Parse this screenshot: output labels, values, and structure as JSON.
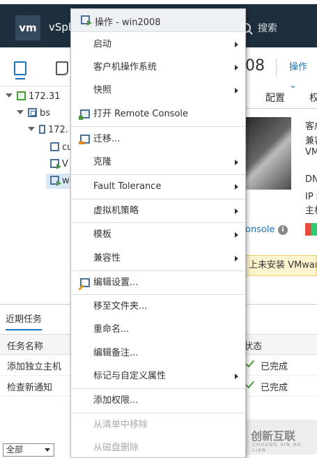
{
  "topbar": {
    "logo": "vm",
    "title": "vSph",
    "search_label": "搜索"
  },
  "tree": {
    "items": [
      {
        "label": "172.31"
      },
      {
        "label": "bs"
      },
      {
        "label": "172."
      },
      {
        "label": "cu"
      },
      {
        "label": "V"
      },
      {
        "label": "wi"
      }
    ]
  },
  "content": {
    "vm_name_fragment": "08",
    "actions_label": "操作 ⌄",
    "tabs": [
      "配置",
      "权"
    ],
    "launch_console_fragment": "onsole",
    "info_icon_glyph": "i",
    "summary_lines": [
      "客户",
      "兼容",
      "VM",
      "DN",
      "IP 地",
      "主机"
    ],
    "warning_fragment": "上未安装 VMware"
  },
  "context_menu": {
    "header": "操作 - win2008",
    "items": [
      {
        "label": "启动",
        "submenu": true
      },
      {
        "label": "客户机操作系统",
        "submenu": true
      },
      {
        "label": "快照",
        "submenu": true
      },
      {
        "label": "打开 Remote Console",
        "icon": "remote-console-icon"
      },
      {
        "label": "迁移...",
        "icon": "migrate-icon"
      },
      {
        "label": "克隆",
        "submenu": true
      },
      {
        "label": "Fault Tolerance",
        "submenu": true
      },
      {
        "label": "虚拟机策略",
        "submenu": true
      },
      {
        "label": "模板",
        "submenu": true
      },
      {
        "label": "兼容性",
        "submenu": true
      },
      {
        "label": "编辑设置...",
        "icon": "edit-settings-icon"
      },
      {
        "label": "移至文件夹..."
      },
      {
        "label": "重命名..."
      },
      {
        "label": "编辑备注..."
      },
      {
        "label": "标记与自定义属性",
        "submenu": true
      },
      {
        "label": "添加权限..."
      },
      {
        "label": "从清单中移除",
        "disabled": true
      },
      {
        "label": "从磁盘删除",
        "disabled": true
      }
    ]
  },
  "tasks": {
    "tab_label": "近期任务",
    "columns": {
      "name": "任务名称",
      "status": "状态"
    },
    "rows": [
      {
        "name": "添加独立主机",
        "status": "已完成"
      },
      {
        "name": "检查新通知",
        "status": "已完成"
      }
    ],
    "filter_value": "全部"
  },
  "watermark": {
    "title": "创新互联",
    "subtitle": "CHUANG XIN HU LIAN"
  }
}
